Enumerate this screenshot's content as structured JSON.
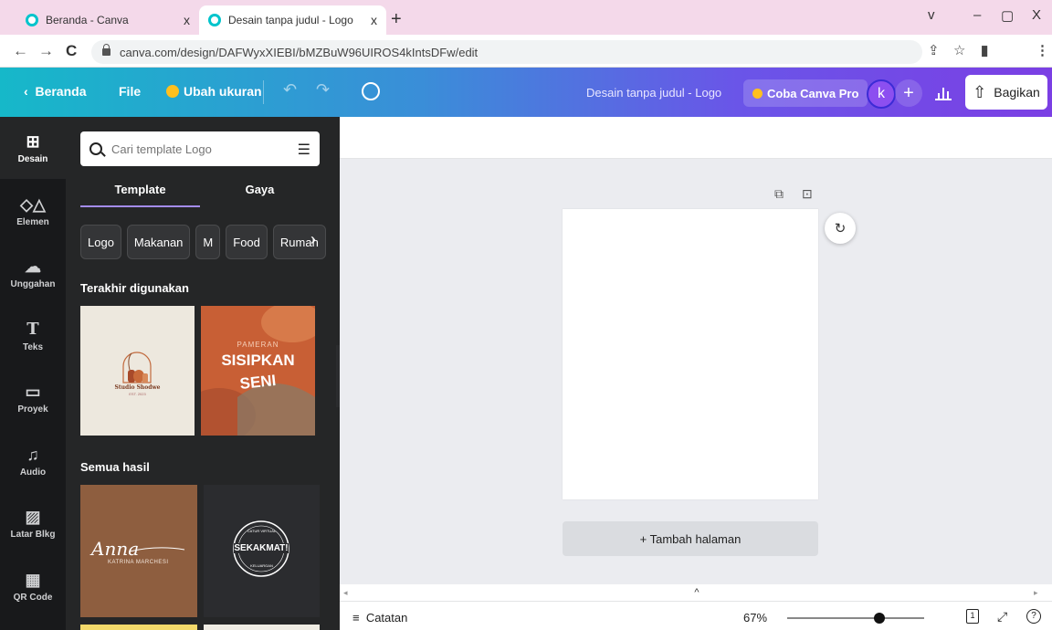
{
  "browser": {
    "tabs": [
      {
        "title": "Beranda - Canva",
        "close": "x"
      },
      {
        "title": "Desain tanpa judul - Logo",
        "close": "x"
      }
    ],
    "new_tab": "+",
    "controls": [
      "v",
      "–",
      "▢",
      "X"
    ],
    "url": "canva.com/design/DAFWyxXIEBI/bMZBuW96UIROS4kIntsDFw/edit",
    "profile_initial": "k",
    "nav_icons": [
      "back-arrow",
      "forward-arrow",
      "reload"
    ]
  },
  "header": {
    "back_label": "Beranda",
    "file_label": "File",
    "resize_label": "Ubah ukuran",
    "design_title": "Desain tanpa judul - Logo",
    "pro_label": "Coba Canva Pro",
    "user_initial": "k",
    "add_label": "+",
    "share_label": "Bagikan",
    "gradient": [
      "#16b8c9",
      "#7b3fe4"
    ]
  },
  "rail": [
    {
      "label": "Desain",
      "icon": "layout-icon",
      "active": true
    },
    {
      "label": "Elemen",
      "icon": "elements-icon",
      "active": false
    },
    {
      "label": "Unggahan",
      "icon": "upload-icon",
      "active": false
    },
    {
      "label": "Teks",
      "icon": "text-icon",
      "active": false
    },
    {
      "label": "Proyek",
      "icon": "folder-icon",
      "active": false
    },
    {
      "label": "Audio",
      "icon": "music-icon",
      "active": false
    },
    {
      "label": "Latar Blkg",
      "icon": "background-icon",
      "active": false
    },
    {
      "label": "QR Code",
      "icon": "qr-icon",
      "active": false
    }
  ],
  "panel": {
    "search_placeholder": "Cari template Logo",
    "tabs": [
      {
        "label": "Template",
        "active": true
      },
      {
        "label": "Gaya",
        "active": false
      }
    ],
    "chips": [
      "Logo",
      "Makanan",
      "M",
      "Food",
      "Rumah"
    ],
    "recent_title": "Terakhir digunakan",
    "all_title": "Semua hasil",
    "templates": {
      "studio": {
        "name": "Studio Shodwe",
        "sub": "EST. 2023"
      },
      "pameran": {
        "line1": "PAMERAN",
        "line2": "SISIPKAN",
        "line3": "SENI"
      },
      "anna": {
        "script": "Anna",
        "name": "KATRINA MARCHESI"
      },
      "sekakmat": {
        "top": "CATUR VIRTUAL",
        "main": "SEKAKMAT!",
        "bottom": "KELUARGAN"
      }
    }
  },
  "canvas": {
    "add_page_label": "+ Tambah halaman",
    "hide_pages_icon": "^"
  },
  "footer": {
    "notes_label": "Catatan",
    "zoom": "67%",
    "zoom_level": 0.67,
    "page_count": "1"
  }
}
